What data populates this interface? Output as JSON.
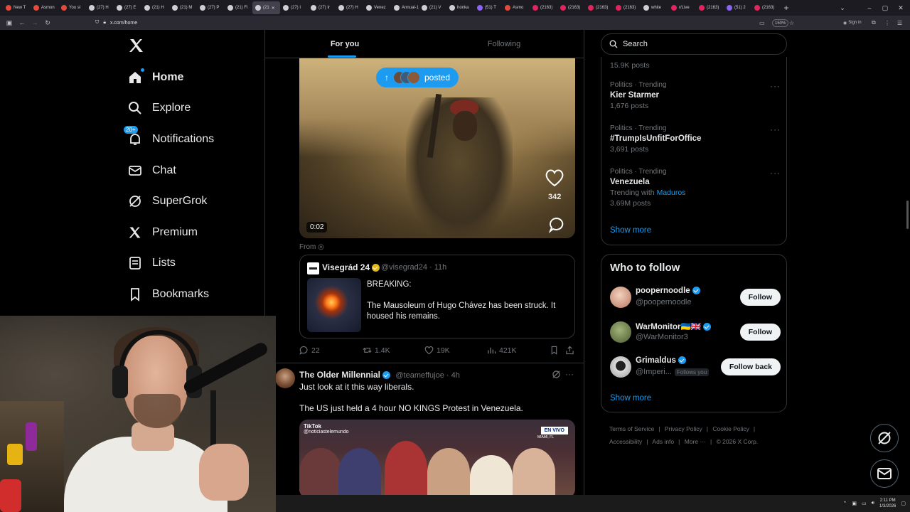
{
  "browser": {
    "tabs": [
      {
        "label": "New T",
        "color": "#e34a3b"
      },
      {
        "label": "Asmon",
        "color": "#e34a3b"
      },
      {
        "label": "You sl",
        "color": "#e34a3b"
      },
      {
        "label": "(27) H",
        "color": "#cfcfd3"
      },
      {
        "label": "(27) E",
        "color": "#cfcfd3"
      },
      {
        "label": "(21) H",
        "color": "#cfcfd3"
      },
      {
        "label": "(21) M",
        "color": "#cfcfd3"
      },
      {
        "label": "(27) P",
        "color": "#cfcfd3"
      },
      {
        "label": "(21) Fi",
        "color": "#cfcfd3"
      },
      {
        "label": "(21",
        "color": "#cfcfd3",
        "active": true
      },
      {
        "label": "(27) I",
        "color": "#cfcfd3"
      },
      {
        "label": "(27) Ir",
        "color": "#cfcfd3"
      },
      {
        "label": "(27) H",
        "color": "#cfcfd3"
      },
      {
        "label": "Venez",
        "color": "#cfcfd3"
      },
      {
        "label": "Annual-1",
        "color": "#cfcfd3"
      },
      {
        "label": "(21) V",
        "color": "#cfcfd3"
      },
      {
        "label": "honka",
        "color": "#cfcfd3"
      },
      {
        "label": "(51) T",
        "color": "#8c63f2"
      },
      {
        "label": "Asmo",
        "color": "#e34a3b"
      },
      {
        "label": "(2163)",
        "color": "#e0245e"
      },
      {
        "label": "(2163)",
        "color": "#e0245e"
      },
      {
        "label": "(2163)",
        "color": "#e0245e"
      },
      {
        "label": "(2163)",
        "color": "#e0245e"
      },
      {
        "label": "white",
        "color": "#cfcfd3"
      },
      {
        "label": "r/Live",
        "color": "#e0245e"
      },
      {
        "label": "(2163)",
        "color": "#e0245e"
      },
      {
        "label": "(51) 2",
        "color": "#8c63f2"
      },
      {
        "label": "(2163)",
        "color": "#e0245e"
      }
    ],
    "url": "x.com/home",
    "zoom": "150%",
    "signin": "Sign in"
  },
  "nav": {
    "items": [
      {
        "label": "Home",
        "icon": "home-icon"
      },
      {
        "label": "Explore",
        "icon": "search-icon"
      },
      {
        "label": "Notifications",
        "icon": "bell-icon",
        "badge": "20+"
      },
      {
        "label": "Chat",
        "icon": "mail-icon"
      },
      {
        "label": "SuperGrok",
        "icon": "grok-icon"
      },
      {
        "label": "Premium",
        "icon": "x-logo-icon"
      },
      {
        "label": "Lists",
        "icon": "list-icon"
      },
      {
        "label": "Bookmarks",
        "icon": "bookmark-icon"
      }
    ]
  },
  "timeline": {
    "tabs": [
      "For you",
      "Following"
    ],
    "posted_pill": "posted",
    "video": {
      "time": "0:02",
      "likes": "342"
    },
    "from_label": "From",
    "quote": {
      "name": "Visegrád 24",
      "handle": "@visegrad24 · 11h",
      "text": "BREAKING:\n\nThe Mausoleum of Hugo Chávez has been struck. It housed his remains."
    },
    "actions": {
      "replies": "22",
      "reposts": "1.4K",
      "likes": "19K",
      "views": "421K"
    },
    "tweet2": {
      "name": "The Older Millennial",
      "meta": "@teameffujoe · 4h",
      "line1": "Just look at it this way liberals.",
      "line2": "The US just held a 4 hour NO KINGS Protest in Venezuela.",
      "tiktok": "TikTok",
      "tiktok_handle": "@noticiastelemundo",
      "live_badge": "EN VIVO",
      "live_location": "MIAMI, FL"
    }
  },
  "right": {
    "search_placeholder": "Search",
    "top_posts": "15.9K posts",
    "trends": [
      {
        "category": "Politics · Trending",
        "title": "Kier Starmer",
        "count": "1,676 posts"
      },
      {
        "category": "Politics · Trending",
        "title": "#TrumpIsUnfitForOffice",
        "count": "3,691 posts"
      },
      {
        "category": "Politics · Trending",
        "title": "Venezuela",
        "with_prefix": "Trending with",
        "with": "Maduros",
        "count": "3.69M posts"
      }
    ],
    "show_more": "Show more",
    "who_to_follow": {
      "title": "Who to follow",
      "users": [
        {
          "name": "poopernoodle",
          "handle": "@poopernoodle",
          "button": "Follow",
          "color": "#d9a08a"
        },
        {
          "name": "WarMonitor🇺🇦🇬🇧",
          "handle": "@WarMonitor3",
          "button": "Follow",
          "color": "#7a8a5a"
        },
        {
          "name": "Grimaldus",
          "handle": "@Imperi...",
          "follows_you": "Follows you",
          "button": "Follow back",
          "color": "#cfcfcf"
        }
      ],
      "show_more": "Show more"
    },
    "footer": [
      "Terms of Service",
      "Privacy Policy",
      "Cookie Policy",
      "Accessibility",
      "Ads info",
      "More ···",
      "© 2026 X Corp."
    ]
  },
  "taskbar": {
    "time": "2:11 PM",
    "date": "1/3/2026"
  },
  "colors": {
    "accent": "#1d9bf0",
    "verified_gold": "#e2b719",
    "verified_blue": "#1d9bf0"
  }
}
